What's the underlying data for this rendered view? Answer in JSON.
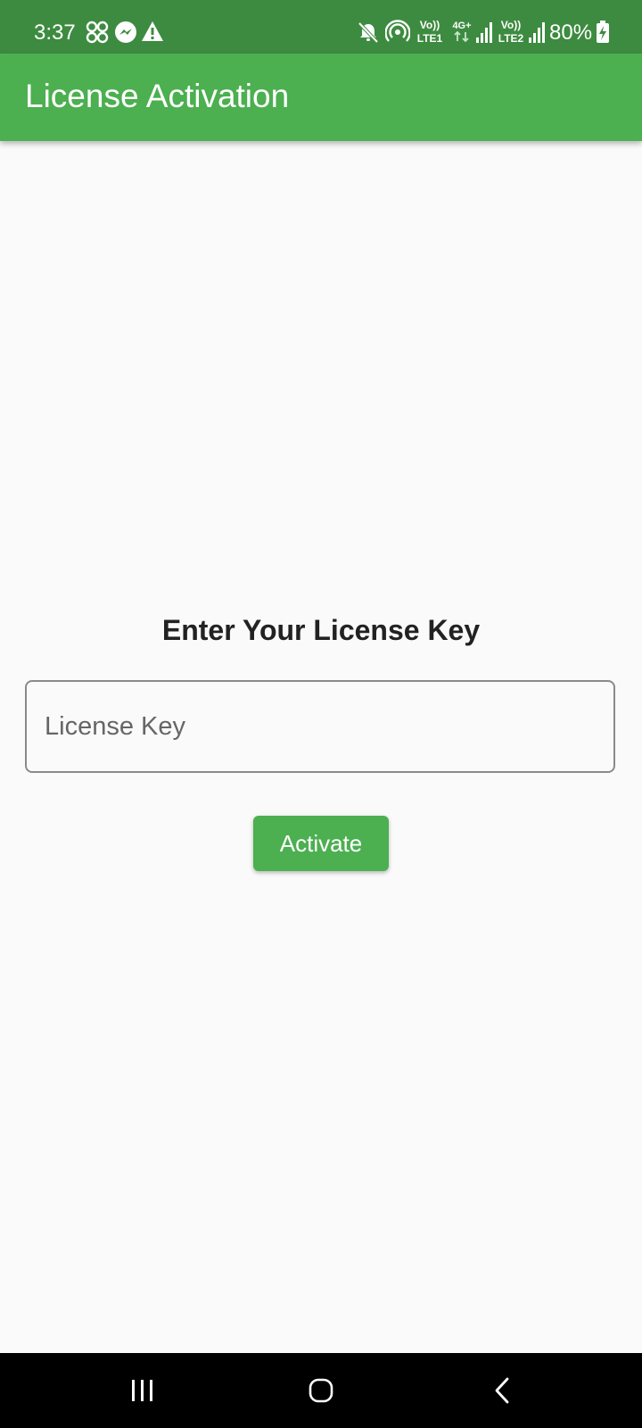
{
  "status_bar": {
    "time": "3:37",
    "icons": [
      "connected-devices-icon",
      "messenger-icon",
      "warning-icon",
      "mute-icon",
      "hotspot-icon",
      "volte-lte1-icon",
      "4g-plus-icon",
      "signal-1-icon",
      "volte-lte2-icon",
      "signal-2-icon",
      "battery-charging-icon"
    ],
    "volte1": "Vo))",
    "lte1": "LTE1",
    "net_type": "4G+",
    "volte2": "Vo))",
    "lte2": "LTE2",
    "battery": "80%",
    "background": "#3d8b40"
  },
  "app_bar": {
    "title": "License Activation",
    "background": "#4caf50"
  },
  "main": {
    "heading": "Enter Your License Key",
    "license_input": {
      "placeholder": "License Key",
      "value": ""
    },
    "activate_label": "Activate",
    "accent": "#4caf50"
  },
  "nav_bar": {
    "buttons": [
      "recent-apps-icon",
      "home-icon",
      "back-icon"
    ],
    "background": "#000000"
  }
}
